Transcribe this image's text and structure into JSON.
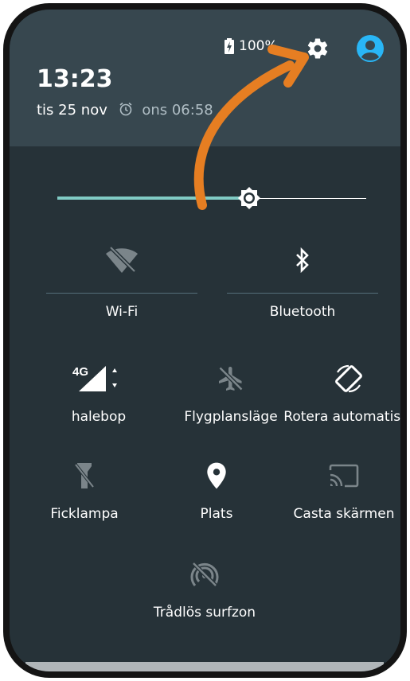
{
  "header": {
    "battery": "100%",
    "time": "13:23",
    "date": "tis 25 nov",
    "alarm": "ons 06:58"
  },
  "brightness": {
    "level": 0.62
  },
  "tiles": [
    {
      "id": "wifi",
      "label": "Wi-Fi",
      "icon": "wifi-off-icon"
    },
    {
      "id": "bluetooth",
      "label": "Bluetooth",
      "icon": "bluetooth-icon"
    },
    {
      "id": "halebop",
      "label": "halebop",
      "icon": "signal-4g-icon"
    },
    {
      "id": "flight",
      "label": "Flygplansläge",
      "icon": "airplane-icon"
    },
    {
      "id": "rotate",
      "label": "Rotera automatiskt",
      "icon": "rotate-icon"
    },
    {
      "id": "flash",
      "label": "Ficklampa",
      "icon": "flashlight-off-icon"
    },
    {
      "id": "location",
      "label": "Plats",
      "icon": "location-pin-icon"
    },
    {
      "id": "cast",
      "label": "Casta skärmen",
      "icon": "cast-icon"
    },
    {
      "id": "hotspot",
      "label": "Trådlös surfzon",
      "icon": "hotspot-off-icon"
    }
  ],
  "signal_label": "4G",
  "colors": {
    "accent": "#80cbc4",
    "header": "#37474f",
    "panel": "#263238",
    "annotation_arrow": "#e67e22"
  }
}
